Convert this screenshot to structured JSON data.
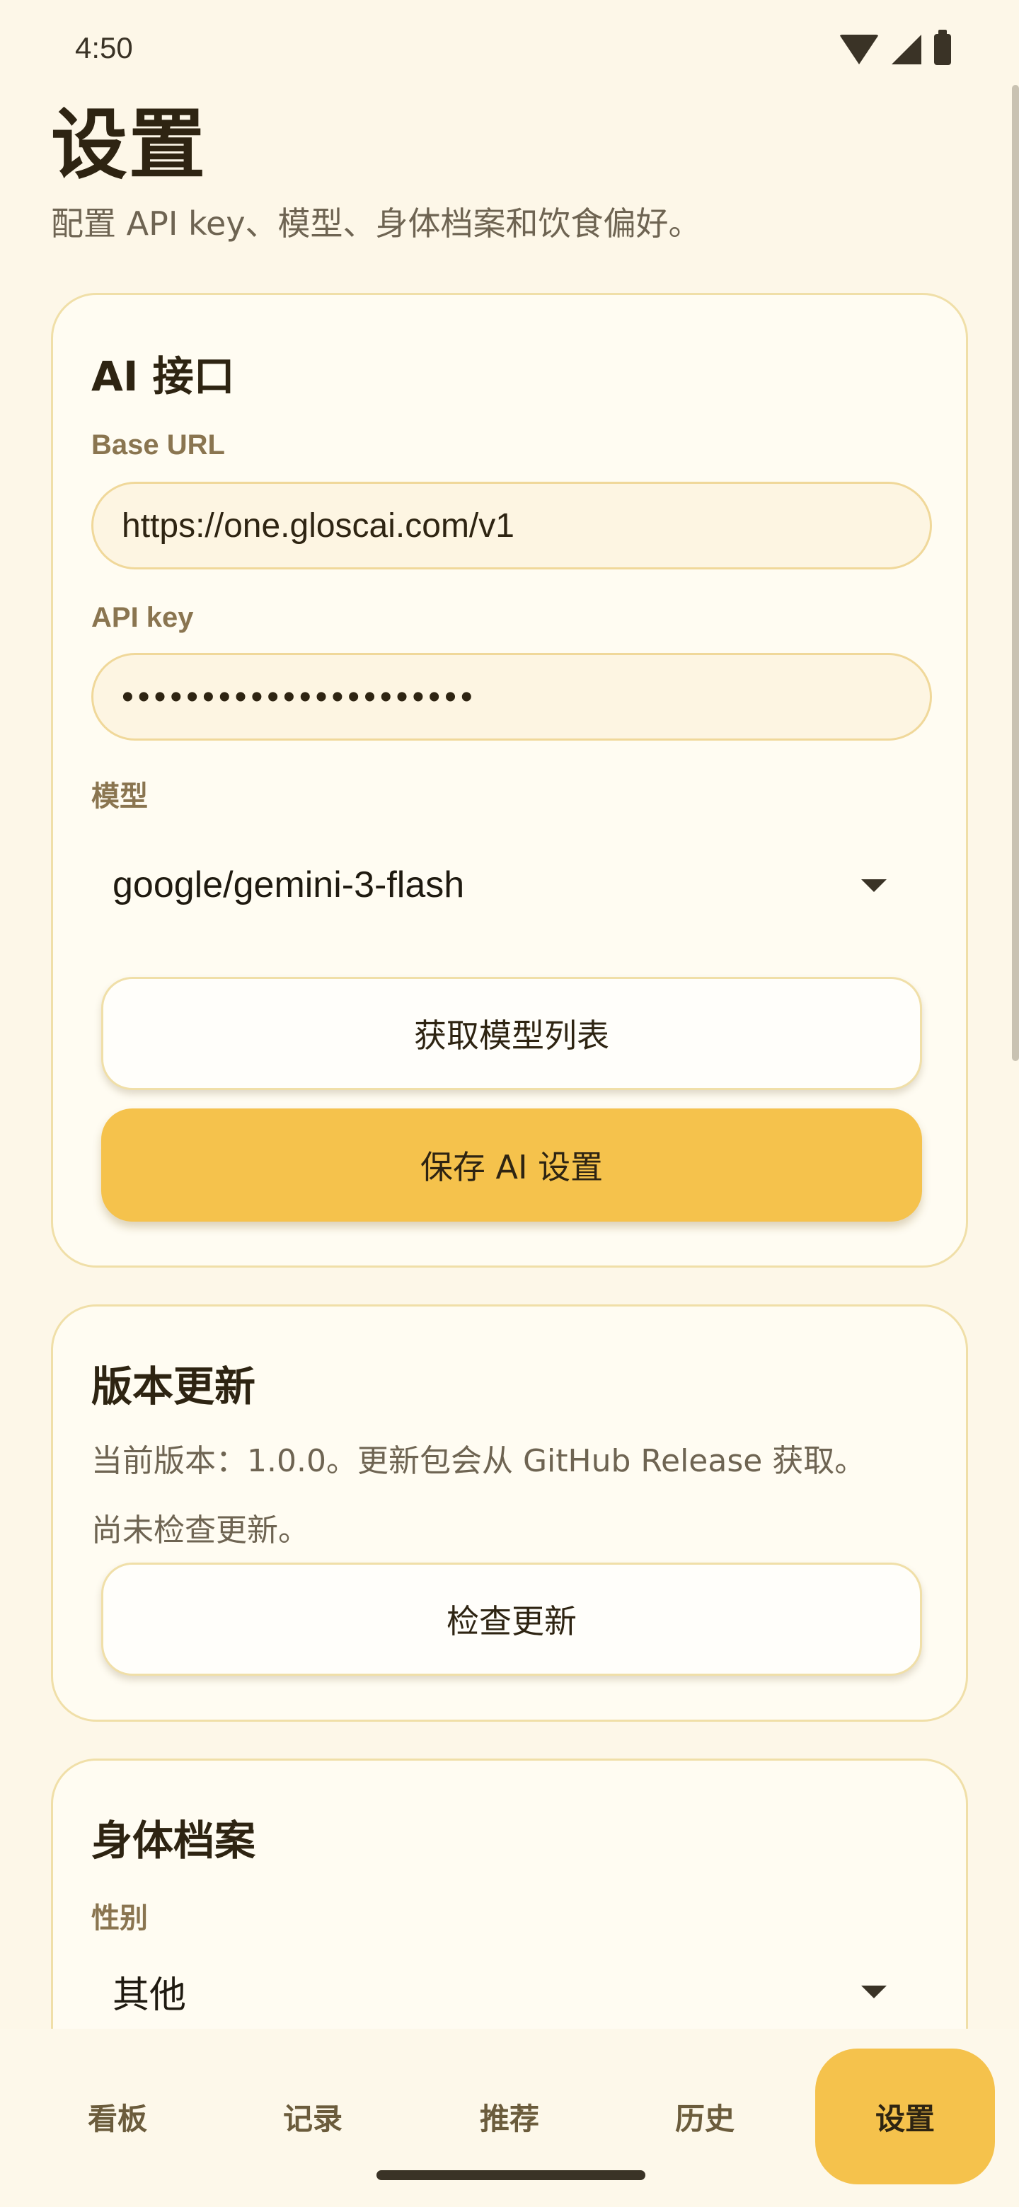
{
  "status_bar": {
    "time": "4:50",
    "icons": [
      "wifi-icon",
      "signal-icon",
      "battery-icon"
    ]
  },
  "header": {
    "title": "设置",
    "subtitle": "配置 API key、模型、身体档案和饮食偏好。"
  },
  "ai_card": {
    "title": "AI 接口",
    "base_url_label": "Base URL",
    "base_url_value": "https://one.gloscai.com/v1",
    "api_key_label": "API key",
    "api_key_value": "••••••••••••••••••••••",
    "model_label": "模型",
    "model_value": "google/gemini-3-flash",
    "fetch_models_label": "获取模型列表",
    "save_label": "保存 AI 设置"
  },
  "version_card": {
    "title": "版本更新",
    "info": "当前版本：1.0.0。更新包会从 GitHub Release 获取。",
    "status": "尚未检查更新。",
    "check_label": "检查更新"
  },
  "profile_card": {
    "title": "身体档案",
    "gender_label": "性别",
    "gender_value": "其他"
  },
  "bottom_nav": {
    "items": [
      {
        "label": "看板",
        "active": false
      },
      {
        "label": "记录",
        "active": false
      },
      {
        "label": "推荐",
        "active": false
      },
      {
        "label": "历史",
        "active": false
      },
      {
        "label": "设置",
        "active": true
      }
    ]
  },
  "colors": {
    "background": "#fdf7e8",
    "accent": "#f5c24c",
    "card": "#fffcf2",
    "border": "#f0dfa8"
  }
}
